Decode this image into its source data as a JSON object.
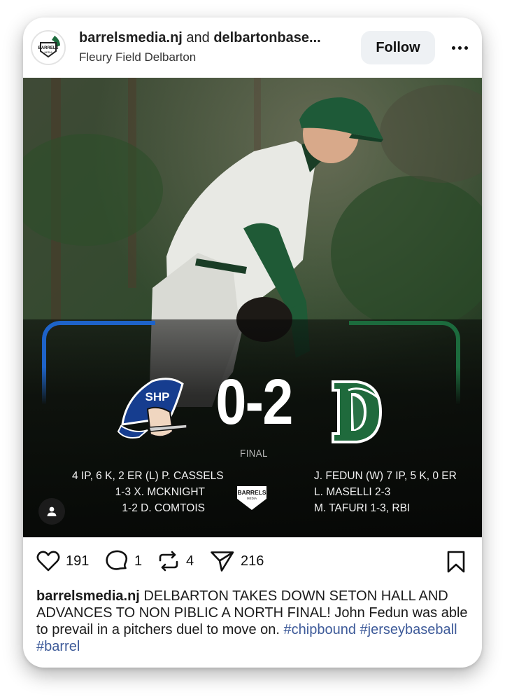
{
  "post": {
    "account_primary": "barrelsmedia.nj",
    "collab_joiner": "and",
    "account_secondary": "delbartonbase...",
    "location": "Fleury Field Delbarton",
    "follow_label": "Follow",
    "avatar_text": "BARRELS",
    "avatar_subtext": "MEDIA"
  },
  "scoreboard": {
    "home_logo_text": "SHP",
    "away_logo_text": "D",
    "score": "0-2",
    "status": "FINAL",
    "left_stats": [
      "4 IP, 6 K, 2 ER (L) P. CASSELS",
      "1-3 X. MCKNIGHT",
      "1-2 D. COMTOIS"
    ],
    "right_stats": [
      "J. FEDUN (W) 7 IP, 5 K, 0 ER",
      "L. MASELLI 2-3",
      "M. TAFURI 1-3, RBI"
    ],
    "center_logo_text": "BARRELS",
    "center_logo_subtext": "MEDIA",
    "left_color": "#1e63c8",
    "right_color": "#1c6b3d"
  },
  "actions": {
    "likes": "191",
    "comments": "1",
    "reposts": "4",
    "shares": "216",
    "icons": [
      "heart-icon",
      "comment-icon",
      "repost-icon",
      "share-icon",
      "bookmark-icon"
    ]
  },
  "caption": {
    "username": "barrelsmedia.nj",
    "text": "DELBARTON TAKES DOWN SETON HALL AND ADVANCES TO NON PIBLIC A NORTH FINAL! John Fedun was able to prevail in a pitchers duel to move on.",
    "hashtags": [
      "#chipbound",
      "#jerseybaseball",
      "#barrel"
    ],
    "hashtag_color": "#3d5a99"
  }
}
